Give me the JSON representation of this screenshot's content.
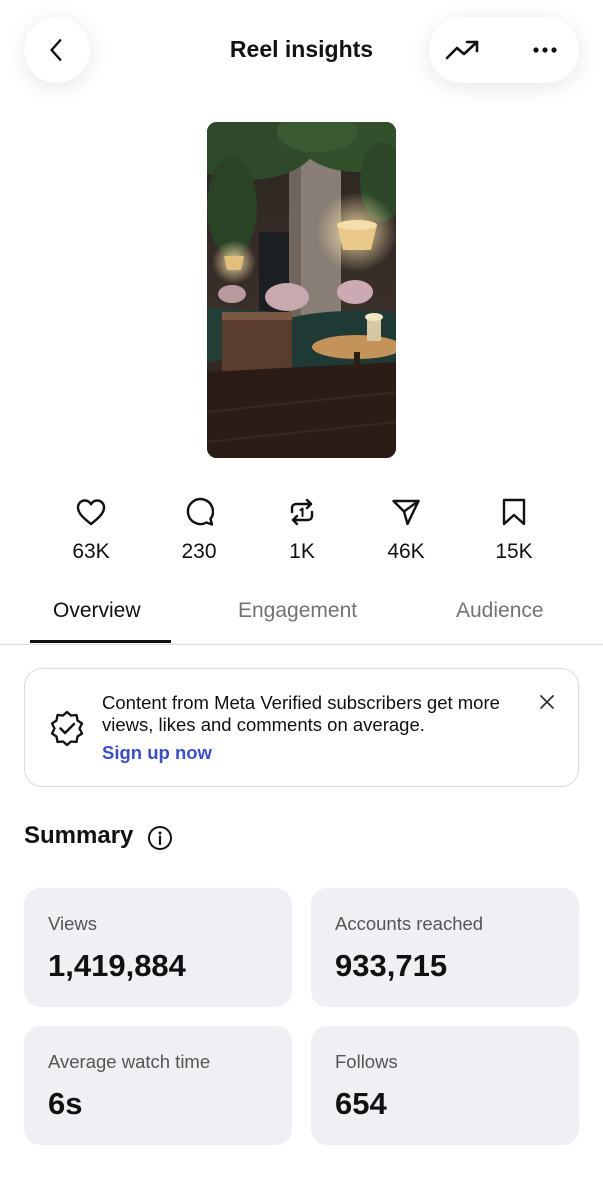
{
  "header": {
    "title": "Reel insights",
    "back_icon": "chevron-left-icon",
    "trend_icon": "trending-up-icon",
    "more_icon": "more-horizontal-icon"
  },
  "reel": {
    "thumbnail": "restaurant-interior-photo"
  },
  "stats": [
    {
      "icon": "heart-icon",
      "value": "63K"
    },
    {
      "icon": "comment-icon",
      "value": "230"
    },
    {
      "icon": "repost-icon",
      "value": "1K"
    },
    {
      "icon": "share-icon",
      "value": "46K"
    },
    {
      "icon": "bookmark-icon",
      "value": "15K"
    }
  ],
  "tabs": [
    {
      "label": "Overview",
      "active": true
    },
    {
      "label": "Engagement",
      "active": false
    },
    {
      "label": "Audience",
      "active": false
    }
  ],
  "banner": {
    "message": "Content from Meta Verified subscribers get more views, likes and comments on average.",
    "cta": "Sign up now",
    "icon": "verified-badge-icon",
    "close_icon": "close-icon"
  },
  "summary": {
    "title": "Summary",
    "info_icon": "info-icon",
    "cards": [
      {
        "label": "Views",
        "value": "1,419,884"
      },
      {
        "label": "Accounts reached",
        "value": "933,715"
      },
      {
        "label": "Average watch time",
        "value": "6s"
      },
      {
        "label": "Follows",
        "value": "654"
      }
    ]
  },
  "colors": {
    "link": "#3a4fc7",
    "card_bg": "#eff0f4",
    "muted_text": "#737373"
  }
}
